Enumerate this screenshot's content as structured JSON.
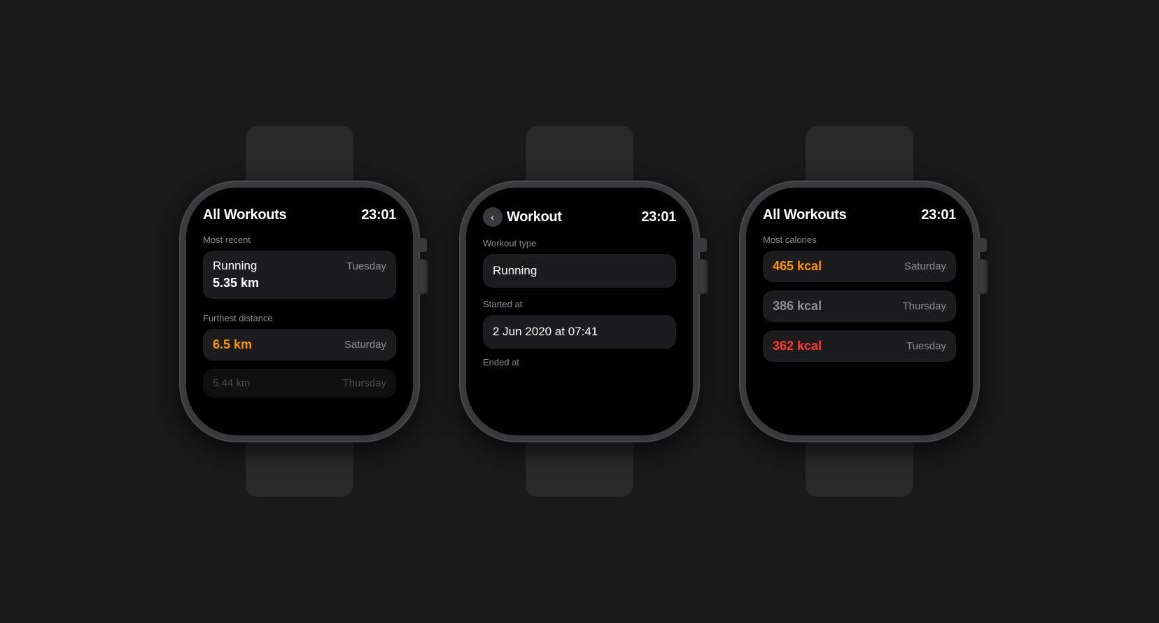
{
  "watches": [
    {
      "id": "watch1",
      "screen": {
        "title": "All Workouts",
        "time": "23:01",
        "has_back": false,
        "sections": [
          {
            "label": "Most recent",
            "cards": [
              {
                "type": "two-line",
                "title": "Running",
                "day": "Tuesday",
                "value": "5.35 km",
                "value_style": "white"
              }
            ]
          },
          {
            "label": "Furthest distance",
            "cards": [
              {
                "type": "two-line",
                "title": "6.5 km",
                "day": "Saturday",
                "value": null,
                "value_style": "orange"
              },
              {
                "type": "two-line",
                "title": "5.44 km",
                "day": "Thursday",
                "value": null,
                "value_style": "gray",
                "faded": true
              }
            ]
          }
        ]
      }
    },
    {
      "id": "watch2",
      "screen": {
        "title": "Workout",
        "time": "23:01",
        "has_back": true,
        "sections": [
          {
            "label": "Workout type",
            "cards": [
              {
                "type": "single",
                "text": "Running"
              }
            ]
          },
          {
            "label": "Started at",
            "cards": [
              {
                "type": "single",
                "text": "2 Jun 2020 at 07:41"
              }
            ]
          },
          {
            "label": "Ended at",
            "partial": true
          }
        ]
      }
    },
    {
      "id": "watch3",
      "screen": {
        "title": "All Workouts",
        "time": "23:01",
        "has_back": false,
        "sections": [
          {
            "label": "Most calories",
            "cards": [
              {
                "title": "465 kcal",
                "day": "Saturday",
                "value_style": "orange"
              },
              {
                "title": "386 kcal",
                "day": "Thursday",
                "value_style": "gray"
              },
              {
                "title": "362 kcal",
                "day": "Tuesday",
                "value_style": "red"
              }
            ]
          }
        ]
      }
    }
  ],
  "colors": {
    "orange": "#ff9500",
    "red": "#ff3b30",
    "gray": "#8e8e93",
    "white": "#ffffff",
    "card_bg": "#1c1c1e",
    "screen_bg": "#000000",
    "watch_body": "#3a3a3c"
  }
}
